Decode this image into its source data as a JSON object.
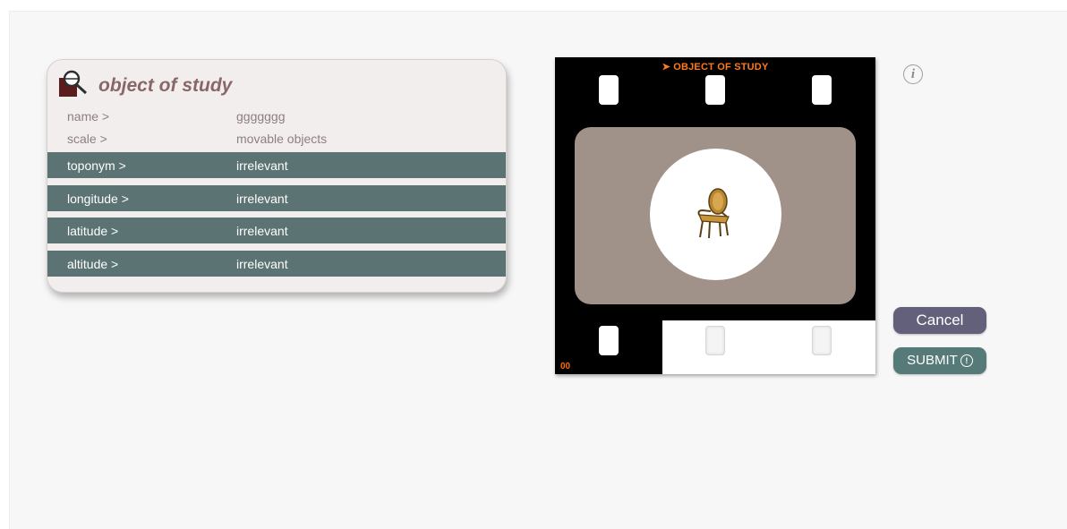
{
  "card": {
    "title": "object of study",
    "icon": "magnifier-document-icon",
    "info_rows": [
      {
        "label": "name >",
        "value": "ggggggg"
      },
      {
        "label": "scale >",
        "value": "movable objects"
      }
    ],
    "bar_rows": [
      {
        "label": "toponym >",
        "value": "irrelevant"
      },
      {
        "label": "longitude >",
        "value": "irrelevant"
      },
      {
        "label": "latitude >",
        "value": "irrelevant"
      },
      {
        "label": "altitude >",
        "value": "irrelevant"
      }
    ]
  },
  "film": {
    "title": "➤ OBJECT OF STUDY",
    "counter": "00",
    "image": "chair-icon"
  },
  "info_button": {
    "glyph": "i"
  },
  "buttons": {
    "cancel": "Cancel",
    "submit": "SUBMIT",
    "submit_icon": "!"
  },
  "colors": {
    "bar": "#5b7373",
    "title": "#8a6767",
    "film_title": "#ff7a1a",
    "cancel": "#62607a",
    "submit": "#567a78"
  }
}
